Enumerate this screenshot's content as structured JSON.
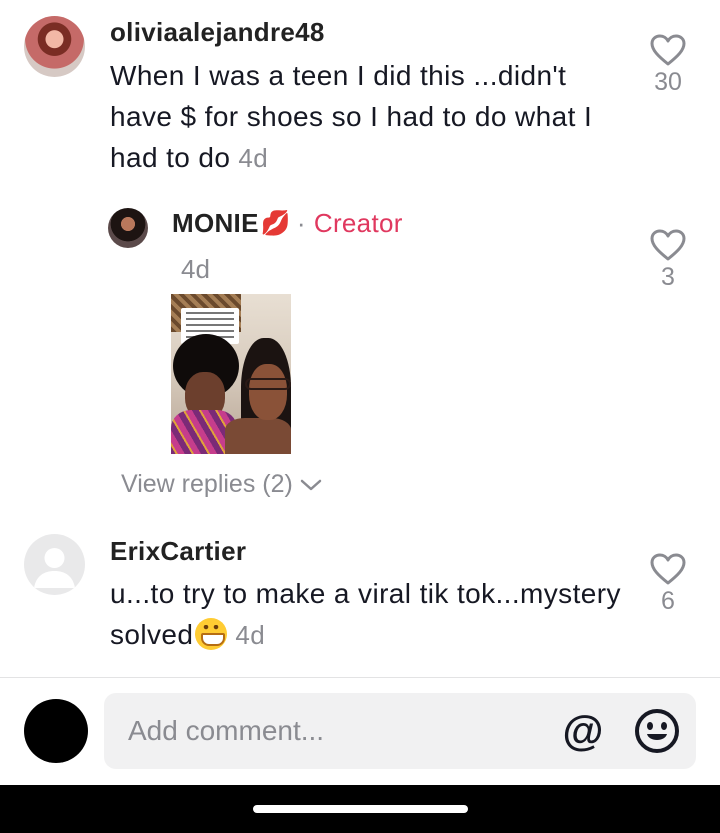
{
  "comments": [
    {
      "username": "oliviaalejandre48",
      "text": "When I was a teen I did this ...didn't have $ for shoes so I had to do what I had to do",
      "time": "4d",
      "likes": "30"
    },
    {
      "username": "MONIE",
      "username_emoji": "💋",
      "separator": "·",
      "badge": "Creator",
      "time": "4d",
      "likes": "3",
      "attachment_icon": "video-thumbnail"
    },
    {
      "username": "ErixCartier",
      "text": "u...to try to make a viral tik tok...mystery solved",
      "text_emoji": "grinning-face",
      "time": "4d",
      "likes": "6"
    }
  ],
  "view_replies": "View replies (2)",
  "composer": {
    "placeholder": "Add comment...",
    "mention_label": "@",
    "emoji_icon": "smiley-icon"
  },
  "colors": {
    "creator_accent": "#e0385f",
    "muted_text": "#8a8b91",
    "composer_bg": "#f1f1f2"
  }
}
